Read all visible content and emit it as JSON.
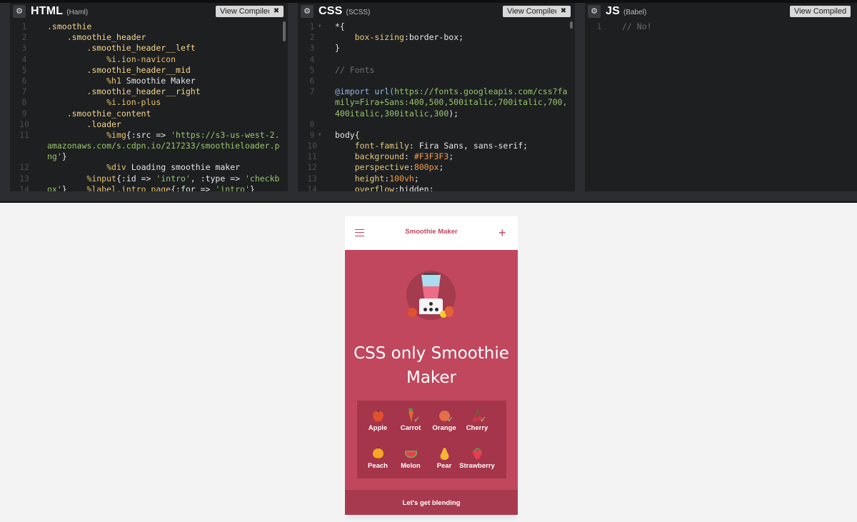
{
  "panes": [
    {
      "lang": "HTML",
      "preprocessor": "(Haml)",
      "view_compiled": "View Compiled",
      "close": "✖",
      "lines": [
        {
          "n": "1",
          "segments": [
            {
              "t": ".smoothie",
              "c": "c-sel"
            }
          ]
        },
        {
          "n": "2",
          "segments": [
            {
              "t": "    .smoothie_header",
              "c": "c-sel"
            }
          ]
        },
        {
          "n": "3",
          "segments": [
            {
              "t": "        .smoothie_header__left",
              "c": "c-sel"
            }
          ]
        },
        {
          "n": "4",
          "segments": [
            {
              "t": "            %i.ion-navicon",
              "c": "c-tag"
            }
          ]
        },
        {
          "n": "5",
          "segments": [
            {
              "t": "        .smoothie_header__mid",
              "c": "c-sel"
            }
          ]
        },
        {
          "n": "6",
          "segments": [
            {
              "t": "            %h1 ",
              "c": "c-tag"
            },
            {
              "t": "Smoothie Maker",
              "c": "c-plain"
            }
          ]
        },
        {
          "n": "7",
          "segments": [
            {
              "t": "        .smoothie_header__right",
              "c": "c-sel"
            }
          ]
        },
        {
          "n": "8",
          "segments": [
            {
              "t": "            %i.ion-plus",
              "c": "c-tag"
            }
          ]
        },
        {
          "n": "9",
          "segments": [
            {
              "t": "    .smoothie_content",
              "c": "c-sel"
            }
          ]
        },
        {
          "n": "10",
          "segments": [
            {
              "t": "        .loader",
              "c": "c-sel"
            }
          ]
        },
        {
          "n": "11",
          "wrap": 3,
          "segments": [
            {
              "t": "            %img",
              "c": "c-tag"
            },
            {
              "t": "{:src => ",
              "c": "c-plain"
            },
            {
              "t": "'https://s3-us-west-2.amazonaws.com/s.cdpn.io/217233/smoothieloader.png'",
              "c": "c-str"
            },
            {
              "t": "}",
              "c": "c-plain"
            }
          ]
        },
        {
          "n": "12",
          "segments": [
            {
              "t": "            %div ",
              "c": "c-tag"
            },
            {
              "t": "Loading smoothie maker",
              "c": "c-plain"
            }
          ]
        },
        {
          "n": "13",
          "segments": [
            {
              "t": "        %input",
              "c": "c-tag"
            },
            {
              "t": "{:id => ",
              "c": "c-plain"
            },
            {
              "t": "'intro'",
              "c": "c-str"
            },
            {
              "t": ", :type => ",
              "c": "c-plain"
            },
            {
              "t": "'checkbox'",
              "c": "c-str"
            },
            {
              "t": "}",
              "c": "c-plain"
            }
          ]
        },
        {
          "n": "14",
          "segments": [
            {
              "t": "        %label.intro_page",
              "c": "c-tag"
            },
            {
              "t": "{:for => ",
              "c": "c-plain"
            },
            {
              "t": "'intro'",
              "c": "c-str"
            },
            {
              "t": "}",
              "c": "c-plain"
            }
          ]
        }
      ]
    },
    {
      "lang": "CSS",
      "preprocessor": "(SCSS)",
      "view_compiled": "View Compiled",
      "close": "✖",
      "lines": [
        {
          "n": "1",
          "fold": true,
          "segments": [
            {
              "t": "*{",
              "c": "c-plain"
            }
          ]
        },
        {
          "n": "2",
          "segments": [
            {
              "t": "    box-sizing",
              "c": "c-prop"
            },
            {
              "t": ":border-box;",
              "c": "c-plain"
            }
          ]
        },
        {
          "n": "3",
          "segments": [
            {
              "t": "}",
              "c": "c-plain"
            }
          ]
        },
        {
          "n": "4",
          "segments": [
            {
              "t": "",
              "c": "c-plain"
            }
          ]
        },
        {
          "n": "5",
          "segments": [
            {
              "t": "// Fonts",
              "c": "c-cmt"
            }
          ]
        },
        {
          "n": "6",
          "segments": [
            {
              "t": "",
              "c": "c-plain"
            }
          ]
        },
        {
          "n": "7",
          "wrap": 3,
          "segments": [
            {
              "t": "@import ",
              "c": "c-at"
            },
            {
              "t": "url(",
              "c": "c-fn"
            },
            {
              "t": "https://fonts.googleapis.com/css?family=Fira+Sans:400,500,500italic,700italic,700,400italic,300italic,300",
              "c": "c-str"
            },
            {
              "t": ");",
              "c": "c-plain"
            }
          ]
        },
        {
          "n": "8",
          "segments": [
            {
              "t": "",
              "c": "c-plain"
            }
          ]
        },
        {
          "n": "9",
          "fold": true,
          "segments": [
            {
              "t": "body{",
              "c": "c-plain"
            }
          ]
        },
        {
          "n": "10",
          "segments": [
            {
              "t": "    font-family",
              "c": "c-prop"
            },
            {
              "t": ": Fira Sans, sans-serif;",
              "c": "c-plain"
            }
          ]
        },
        {
          "n": "11",
          "segments": [
            {
              "t": "    background",
              "c": "c-prop"
            },
            {
              "t": ": ",
              "c": "c-plain"
            },
            {
              "t": "#F3F3F3",
              "c": "c-num"
            },
            {
              "t": ";",
              "c": "c-plain"
            }
          ]
        },
        {
          "n": "12",
          "segments": [
            {
              "t": "    perspective",
              "c": "c-prop"
            },
            {
              "t": ":",
              "c": "c-plain"
            },
            {
              "t": "800px",
              "c": "c-num"
            },
            {
              "t": ";",
              "c": "c-plain"
            }
          ]
        },
        {
          "n": "13",
          "segments": [
            {
              "t": "    height",
              "c": "c-prop"
            },
            {
              "t": ":",
              "c": "c-plain"
            },
            {
              "t": "100vh",
              "c": "c-num"
            },
            {
              "t": ";",
              "c": "c-plain"
            }
          ]
        },
        {
          "n": "14",
          "segments": [
            {
              "t": "    overflow",
              "c": "c-prop"
            },
            {
              "t": ":hidden;",
              "c": "c-plain"
            }
          ]
        }
      ]
    },
    {
      "lang": "JS",
      "preprocessor": "(Babel)",
      "view_compiled": "View Compiled",
      "close": "",
      "lines": [
        {
          "n": "1",
          "segments": [
            {
              "t": "// No!",
              "c": "c-cmt"
            }
          ]
        }
      ]
    }
  ],
  "preview": {
    "header_title": "Smoothie Maker",
    "menu_icon": "hamburger-icon",
    "add_icon": "plus-icon",
    "hero_title": "CSS only Smoothie Maker",
    "fruits": [
      {
        "name": "Apple",
        "checked": false,
        "color": "#e0512f"
      },
      {
        "name": "Carrot",
        "checked": true,
        "color": "#e06a2c"
      },
      {
        "name": "Orange",
        "checked": true,
        "color": "#e3704a"
      },
      {
        "name": "Cherry",
        "checked": true,
        "color": "#c8374c"
      },
      {
        "name": "Peach",
        "checked": false,
        "color": "#f5a623"
      },
      {
        "name": "Melon",
        "checked": false,
        "color": "#e5404e"
      },
      {
        "name": "Pear",
        "checked": false,
        "color": "#f5b731"
      },
      {
        "name": "Strawberry",
        "checked": false,
        "color": "#e5404e"
      }
    ],
    "cta": "Let's get blending"
  },
  "colors": {
    "brand": "#c0475e",
    "grid": "#a5354a",
    "check": "#8edb5e"
  }
}
